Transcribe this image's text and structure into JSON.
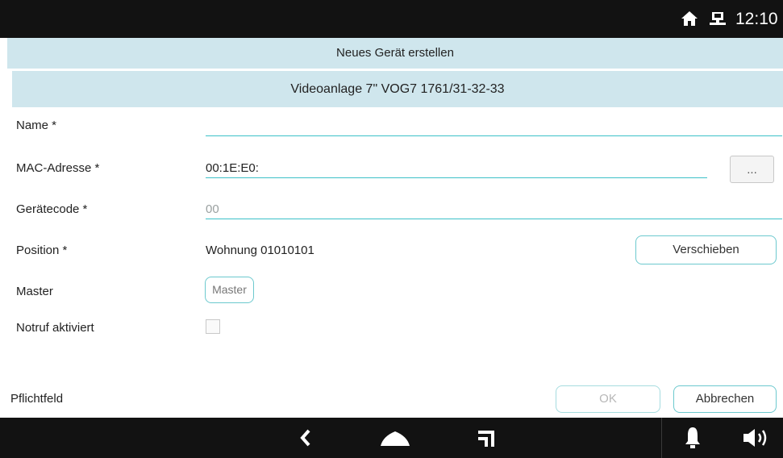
{
  "status_bar": {
    "time": "12:10",
    "icons": [
      "home-icon",
      "network-icon"
    ]
  },
  "dialog": {
    "title": "Neues Gerät erstellen",
    "device_type": "Videoanlage 7\" VOG7 1761/31-32-33",
    "fields": {
      "name": {
        "label": "Name *",
        "value": ""
      },
      "mac": {
        "label": "MAC-Adresse *",
        "value": "00:1E:E0:",
        "button_label": "..."
      },
      "device_code": {
        "label": "Gerätecode *",
        "placeholder": "00"
      },
      "position": {
        "label": "Position *",
        "value": "Wohnung 01010101",
        "button_label": "Verschieben"
      },
      "master": {
        "label": "Master",
        "button_label": "Master"
      },
      "emergency": {
        "label": "Notruf aktiviert",
        "checked": false
      }
    },
    "footer": {
      "required_note": "Pflichtfeld",
      "ok_label": "OK",
      "cancel_label": "Abbrechen"
    }
  },
  "nav_bar": {
    "icons": [
      "back-icon",
      "home-icon",
      "recent-apps-icon",
      "bell-icon",
      "speaker-icon"
    ]
  },
  "colors": {
    "accent": "#3dc1c8",
    "header_bg": "#cfe6ed",
    "bar_bg": "#121212"
  }
}
